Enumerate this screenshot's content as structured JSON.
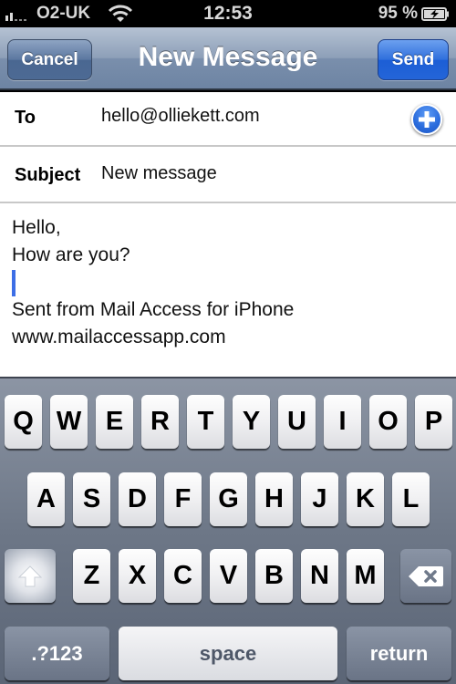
{
  "status_bar": {
    "carrier": "O2-UK",
    "time": "12:53",
    "battery_percent": "95 %",
    "icons": [
      "signal-strength-icon",
      "wifi-icon",
      "battery-charging-icon"
    ]
  },
  "nav_bar": {
    "title": "New Message",
    "cancel_label": "Cancel",
    "send_label": "Send"
  },
  "fields": {
    "to_label": "To",
    "to_value": "hello@olliekett.com",
    "add_contact_icon": "add-contact-icon",
    "subject_label": "Subject",
    "subject_value": "New message"
  },
  "message": {
    "lines": [
      "Hello,",
      "How are you?",
      "",
      "Sent from Mail Access for iPhone",
      "www.mailaccessapp.com"
    ]
  },
  "keyboard": {
    "row1": [
      "Q",
      "W",
      "E",
      "R",
      "T",
      "Y",
      "U",
      "I",
      "O",
      "P"
    ],
    "row2": [
      "A",
      "S",
      "D",
      "F",
      "G",
      "H",
      "J",
      "K",
      "L"
    ],
    "row3": [
      "Z",
      "X",
      "C",
      "V",
      "B",
      "N",
      "M"
    ],
    "numbers_label": ".?123",
    "space_label": "space",
    "return_label": "return",
    "shift_icon": "shift-icon",
    "delete_icon": "delete-icon"
  },
  "colors": {
    "send_button": "#2465d8",
    "cancel_button": "#4d6a94",
    "caret": "#3d6ee6"
  }
}
